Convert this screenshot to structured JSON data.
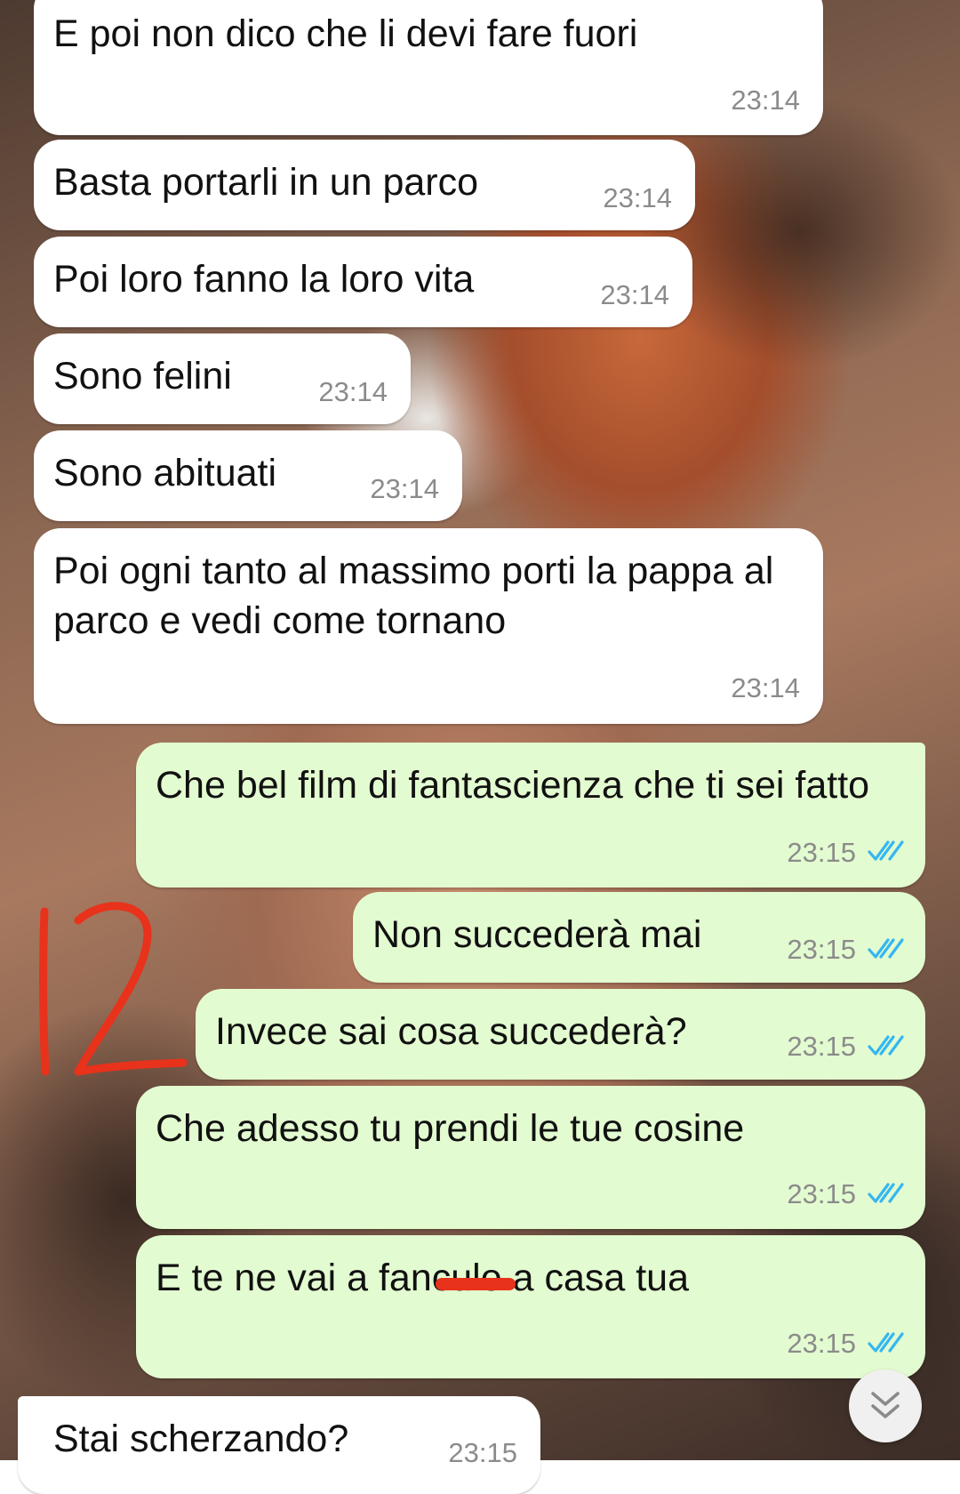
{
  "chat": {
    "messages": [
      {
        "direction": "in",
        "text": "E poi non dico che li devi fare fuori",
        "time": "23:14"
      },
      {
        "direction": "in",
        "text": "Basta portarli in un parco",
        "time": "23:14"
      },
      {
        "direction": "in",
        "text": "Poi loro fanno la loro vita",
        "time": "23:14"
      },
      {
        "direction": "in",
        "text": "Sono felini",
        "time": "23:14"
      },
      {
        "direction": "in",
        "text": "Sono abituati",
        "time": "23:14"
      },
      {
        "direction": "in",
        "text": "Poi ogni tanto al massimo porti la pappa al parco e vedi come tornano",
        "time": "23:14"
      },
      {
        "direction": "out",
        "text": "Che bel film di fantascienza che ti sei fatto",
        "time": "23:15",
        "status": "read"
      },
      {
        "direction": "out",
        "text": "Non succederà mai",
        "time": "23:15",
        "status": "read"
      },
      {
        "direction": "out",
        "text": "Invece sai cosa succederà?",
        "time": "23:15",
        "status": "read"
      },
      {
        "direction": "out",
        "text": "Che adesso tu prendi le tue cosine",
        "time": "23:15",
        "status": "read"
      },
      {
        "direction": "out",
        "text": "E te ne vai a fanculo a casa tua",
        "time": "23:15",
        "status": "read"
      },
      {
        "direction": "in",
        "text": "Stai scherzando?",
        "time": "23:15"
      }
    ]
  },
  "annotation": {
    "text": "12",
    "color": "#e8321b"
  },
  "colors": {
    "incoming_bubble": "#ffffff",
    "outgoing_bubble": "#e3fbd0",
    "read_ticks": "#34b7f1"
  },
  "icons": {
    "read_receipt": "double-check-icon",
    "scroll_down": "double-chevron-down-icon"
  }
}
